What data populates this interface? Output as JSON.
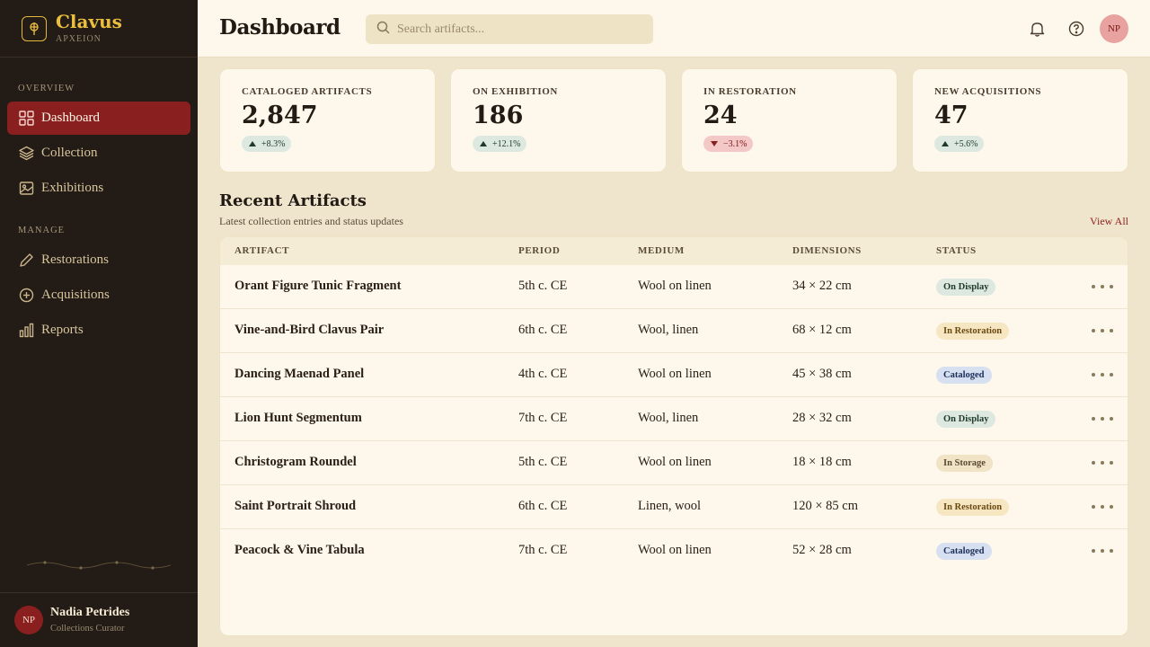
{
  "brand": {
    "name": "Clavus",
    "subtitle": "APXEION"
  },
  "sidebar": {
    "sections": [
      {
        "label": "OVERVIEW",
        "items": [
          {
            "label": "Dashboard",
            "icon": "grid-icon",
            "active": true
          },
          {
            "label": "Collection",
            "icon": "layers-icon"
          },
          {
            "label": "Exhibitions",
            "icon": "image-icon"
          }
        ]
      },
      {
        "label": "MANAGE",
        "items": [
          {
            "label": "Restorations",
            "icon": "pencil-icon"
          },
          {
            "label": "Acquisitions",
            "icon": "plus-circle-icon"
          },
          {
            "label": "Reports",
            "icon": "bar-chart-icon"
          }
        ]
      }
    ],
    "user": {
      "initials": "NP",
      "name": "Nadia Petrides",
      "role": "Collections Curator"
    }
  },
  "header": {
    "title": "Dashboard",
    "search_placeholder": "Search artifacts...",
    "avatar_initials": "NP"
  },
  "stats": [
    {
      "label": "CATALOGED ARTIFACTS",
      "value": "2,847",
      "delta": "+8.3%",
      "trend": "up"
    },
    {
      "label": "ON EXHIBITION",
      "value": "186",
      "delta": "+12.1%",
      "trend": "up"
    },
    {
      "label": "IN RESTORATION",
      "value": "24",
      "delta": "−3.1%",
      "trend": "down"
    },
    {
      "label": "NEW ACQUISITIONS",
      "value": "47",
      "delta": "+5.6%",
      "trend": "up"
    }
  ],
  "recent": {
    "title": "Recent Artifacts",
    "subtitle": "Latest collection entries and status updates",
    "view_all": "View All",
    "columns": [
      "ARTIFACT",
      "PERIOD",
      "MEDIUM",
      "DIMENSIONS",
      "STATUS"
    ],
    "rows": [
      {
        "name": "Orant Figure Tunic Fragment",
        "period": "5th c. CE",
        "medium": "Wool on linen",
        "dimensions": "34 × 22 cm",
        "status": "On Display"
      },
      {
        "name": "Vine-and-Bird Clavus Pair",
        "period": "6th c. CE",
        "medium": "Wool, linen",
        "dimensions": "68 × 12 cm",
        "status": "In Restoration"
      },
      {
        "name": "Dancing Maenad Panel",
        "period": "4th c. CE",
        "medium": "Wool on linen",
        "dimensions": "45 × 38 cm",
        "status": "Cataloged"
      },
      {
        "name": "Lion Hunt Segmentum",
        "period": "7th c. CE",
        "medium": "Wool, linen",
        "dimensions": "28 × 32 cm",
        "status": "On Display"
      },
      {
        "name": "Christogram Roundel",
        "period": "5th c. CE",
        "medium": "Wool on linen",
        "dimensions": "18 × 18 cm",
        "status": "In Storage"
      },
      {
        "name": "Saint Portrait Shroud",
        "period": "6th c. CE",
        "medium": "Linen, wool",
        "dimensions": "120 × 85 cm",
        "status": "In Restoration"
      },
      {
        "name": "Peacock & Vine Tabula",
        "period": "7th c. CE",
        "medium": "Wool on linen",
        "dimensions": "52 × 28 cm",
        "status": "Cataloged"
      }
    ]
  },
  "status_colors": {
    "On Display": {
      "bg": "#dde9e0",
      "fg": "#1f3a2a"
    },
    "In Restoration": {
      "bg": "#f6e6c2",
      "fg": "#6a4a10"
    },
    "Cataloged": {
      "bg": "#d6e0f0",
      "fg": "#1c2e5a"
    },
    "In Storage": {
      "bg": "#f0e3c6",
      "fg": "#5a4a30"
    }
  },
  "colors": {
    "accent": "#8a1f1f",
    "brand": "#ebbe3d",
    "sidebar": "#221b16",
    "background": "#efe5cc"
  }
}
